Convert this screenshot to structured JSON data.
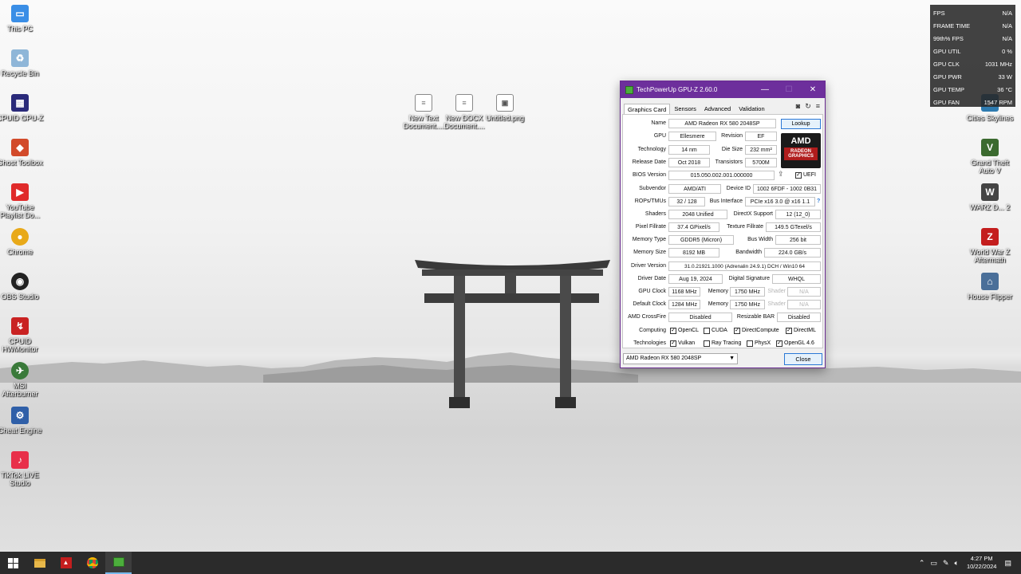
{
  "desktop_icons_left": [
    {
      "label": "This PC",
      "icon": "computer-icon",
      "color": "#3a8ee6"
    },
    {
      "label": "Recycle Bin",
      "icon": "recycle-bin-icon",
      "color": "#8fb6d8"
    },
    {
      "label": "CPUID GPU-Z",
      "icon": "gpuz-icon",
      "color": "#2a2a7a"
    },
    {
      "label": "Ghost Toolbox",
      "icon": "ghost-icon",
      "color": "#d24a2a"
    },
    {
      "label": "YouTube Playlist Do...",
      "icon": "youtube-icon",
      "color": "#e02b2b"
    },
    {
      "label": "Chrome",
      "icon": "chrome-icon",
      "color": "#e8a919"
    },
    {
      "label": "OBS Studio",
      "icon": "obs-icon",
      "color": "#222222"
    },
    {
      "label": "CPUID HWMonitor",
      "icon": "hwmonitor-icon",
      "color": "#c92222"
    },
    {
      "label": "MSI Afterburner",
      "icon": "afterburner-icon",
      "color": "#3a7a3a"
    },
    {
      "label": "Cheat Engine",
      "icon": "cheat-engine-icon",
      "color": "#2f5fa8"
    },
    {
      "label": "TikTok LIVE Studio",
      "icon": "tiktok-icon",
      "color": "#e8304a"
    }
  ],
  "desktop_icons_middle": [
    {
      "label": "New Text Document....",
      "icon": "text-file-icon"
    },
    {
      "label": "New DOCX Document....",
      "icon": "docx-file-icon"
    },
    {
      "label": "Untitled.png",
      "icon": "image-file-icon"
    }
  ],
  "desktop_icons_right": [
    {
      "label": "Cities Skylines",
      "icon": "cities-skylines-icon",
      "color": "#2e7bb0"
    },
    {
      "label": "Grand Theft Auto V",
      "icon": "gta-icon",
      "color": "#3b6a2f"
    },
    {
      "label": "WARZ D... 2",
      "icon": "warz-icon",
      "color": "#444444"
    },
    {
      "label": "World War Z Aftermath",
      "icon": "wwz-icon",
      "color": "#c41e1e"
    },
    {
      "label": "House Flipper",
      "icon": "house-flipper-icon",
      "color": "#4a6f99"
    }
  ],
  "osd": [
    {
      "label": "FPS",
      "value": "N/A"
    },
    {
      "label": "FRAME TIME",
      "value": "N/A"
    },
    {
      "label": "99th% FPS",
      "value": "N/A"
    },
    {
      "label": "GPU UTIL",
      "value": "0 %"
    },
    {
      "label": "GPU CLK",
      "value": "1031 MHz"
    },
    {
      "label": "GPU PWR",
      "value": "33 W"
    },
    {
      "label": "GPU TEMP",
      "value": "36 °C"
    },
    {
      "label": "GPU FAN",
      "value": "1547 RPM"
    }
  ],
  "gpuz": {
    "title": "TechPowerUp GPU-Z 2.60.0",
    "tabs": [
      "Graphics Card",
      "Sensors",
      "Advanced",
      "Validation"
    ],
    "labels": {
      "name": "Name",
      "gpu": "GPU",
      "revision": "Revision",
      "technology": "Technology",
      "die_size": "Die Size",
      "release_date": "Release Date",
      "transistors": "Transistors",
      "bios": "BIOS Version",
      "uefi": "UEFI",
      "subvendor": "Subvendor",
      "device_id": "Device ID",
      "rops": "ROPs/TMUs",
      "bus": "Bus Interface",
      "shaders": "Shaders",
      "directx": "DirectX Support",
      "pixel": "Pixel Fillrate",
      "texture": "Texture Fillrate",
      "mem_type": "Memory Type",
      "bus_width": "Bus Width",
      "mem_size": "Memory Size",
      "bandwidth": "Bandwidth",
      "driver_version": "Driver Version",
      "driver_date": "Driver Date",
      "digital_sig": "Digital Signature",
      "gpu_clock": "GPU Clock",
      "memory": "Memory",
      "shader": "Shader",
      "default_clock": "Default Clock",
      "crossfire": "AMD CrossFire",
      "rebar": "Resizable BAR",
      "computing": "Computing",
      "technologies": "Technologies"
    },
    "values": {
      "name": "AMD Radeon RX 580 2048SP",
      "lookup": "Lookup",
      "gpu": "Ellesmere",
      "revision": "EF",
      "technology": "14 nm",
      "die_size": "232 mm²",
      "release_date": "Oct 2018",
      "transistors": "5700M",
      "bios": "015.050.002.001.000000",
      "subvendor": "AMD/ATI",
      "device_id": "1002 6FDF - 1002 0B31",
      "rops": "32 / 128",
      "bus": "PCIe x16 3.0 @ x16 1.1",
      "bus_help": "?",
      "shaders": "2048 Unified",
      "directx": "12 (12_0)",
      "pixel": "37.4 GPixel/s",
      "texture": "149.5 GTexel/s",
      "mem_type": "GDDR5 (Micron)",
      "bus_width": "256 bit",
      "mem_size": "8192 MB",
      "bandwidth": "224.0 GB/s",
      "driver_version": "31.0.21921.1000 (Adrenalin 24.9.1) DCH / Win10 64",
      "driver_date": "Aug 19, 2024",
      "digital_sig": "WHQL",
      "gpu_clock": "1168 MHz",
      "gpu_mem": "1750 MHz",
      "gpu_shader": "N/A",
      "default_clock": "1284 MHz",
      "def_mem": "1750 MHz",
      "def_shader": "N/A",
      "crossfire": "Disabled",
      "rebar": "Disabled"
    },
    "computing": [
      {
        "label": "OpenCL",
        "checked": true
      },
      {
        "label": "CUDA",
        "checked": false
      },
      {
        "label": "DirectCompute",
        "checked": true
      },
      {
        "label": "DirectML",
        "checked": true
      }
    ],
    "technologies": [
      {
        "label": "Vulkan",
        "checked": true
      },
      {
        "label": "Ray Tracing",
        "checked": false
      },
      {
        "label": "PhysX",
        "checked": false
      },
      {
        "label": "OpenGL 4.6",
        "checked": true
      }
    ],
    "logo_brand": "AMD",
    "logo_sub": "RADEON GRAPHICS",
    "select_value": "AMD Radeon RX 580 2048SP",
    "close_label": "Close"
  },
  "taskbar": {
    "time": "4:27 PM",
    "date": "10/22/2024"
  }
}
